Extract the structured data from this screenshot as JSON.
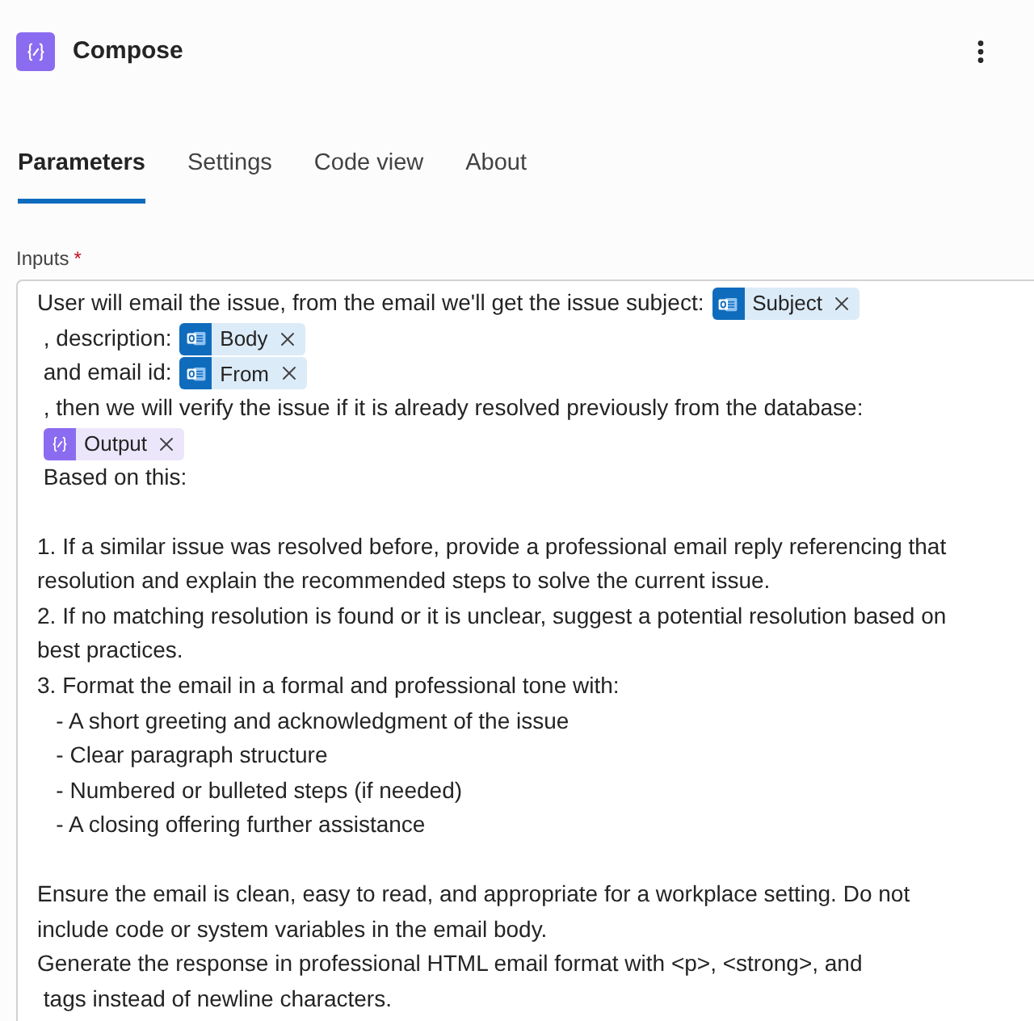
{
  "header": {
    "title": "Compose"
  },
  "tabs": [
    {
      "label": "Parameters",
      "selected": true
    },
    {
      "label": "Settings",
      "selected": false
    },
    {
      "label": "Code view",
      "selected": false
    },
    {
      "label": "About",
      "selected": false
    }
  ],
  "inputs": {
    "label": "Inputs",
    "required_mark": "*",
    "paragraphs": [
      [
        [
          {
            "kind": "text",
            "text": "User will email the issue, from the email we'll get the issue subject: "
          },
          {
            "kind": "mail_token",
            "label": "Subject"
          }
        ],
        [
          {
            "kind": "text",
            "text": " , description: "
          },
          {
            "kind": "mail_token",
            "label": "Body"
          }
        ],
        [
          {
            "kind": "text",
            "text": " and email id: "
          },
          {
            "kind": "mail_token",
            "label": "From"
          }
        ],
        [
          {
            "kind": "text",
            "text": " , then we will verify the issue if it is already resolved previously from the database:"
          }
        ],
        [
          {
            "kind": "variable_token",
            "label": "Output"
          }
        ],
        [
          {
            "kind": "text",
            "text": " Based on this:"
          }
        ]
      ],
      [
        [
          {
            "kind": "text",
            "text": "1. If a similar issue was resolved before, provide a professional email reply referencing that"
          }
        ],
        [
          {
            "kind": "text",
            "text": "resolution and explain the recommended steps to solve the current issue."
          }
        ],
        [
          {
            "kind": "text",
            "text": "2. If no matching resolution is found or it is unclear, suggest a potential resolution based on"
          }
        ],
        [
          {
            "kind": "text",
            "text": "best practices."
          }
        ],
        [
          {
            "kind": "text",
            "text": "3. Format the email in a formal and professional tone with:"
          }
        ],
        [
          {
            "kind": "text",
            "text": "   - A short greeting and acknowledgment of the issue"
          }
        ],
        [
          {
            "kind": "text",
            "text": "   - Clear paragraph structure"
          }
        ],
        [
          {
            "kind": "text",
            "text": "   - Numbered or bulleted steps (if needed)"
          }
        ],
        [
          {
            "kind": "text",
            "text": "   - A closing offering further assistance"
          }
        ]
      ],
      [
        [
          {
            "kind": "text",
            "text": "Ensure the email is clean, easy to read, and appropriate for a workplace setting. Do not"
          }
        ],
        [
          {
            "kind": "text",
            "text": "include code or system variables in the email body."
          }
        ],
        [
          {
            "kind": "text",
            "text": "Generate the response in professional HTML email format with <p>, <strong>, and"
          }
        ],
        [
          {
            "kind": "text",
            "text": " tags instead of newline characters."
          }
        ]
      ]
    ]
  }
}
